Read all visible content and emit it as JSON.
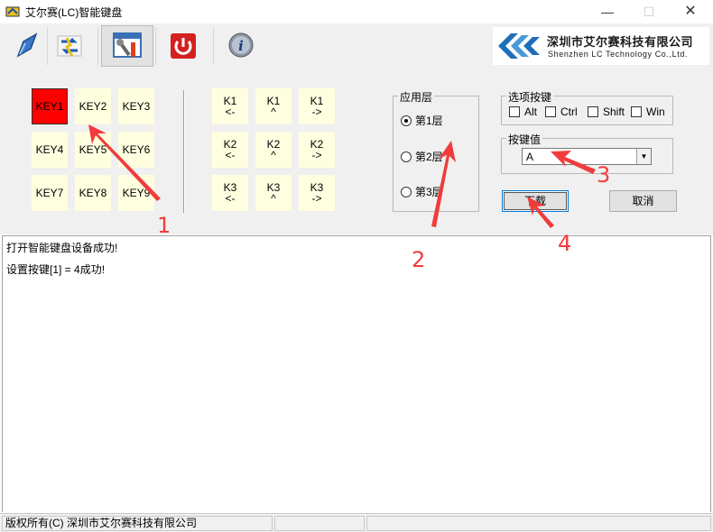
{
  "window": {
    "title": "艾尔赛(LC)智能键盘",
    "minimize": "—",
    "maximize": "☐",
    "close": "✕"
  },
  "toolbar": {
    "buttons": [
      {
        "icon": "connect-icon"
      },
      {
        "icon": "exchange-icon"
      },
      {
        "icon": "tools-settings-icon"
      },
      {
        "icon": "power-icon"
      },
      {
        "icon": "info-icon"
      }
    ]
  },
  "logo": {
    "company_cn": "深圳市艾尔赛科技有限公司",
    "company_en": "Shenzhen LC Technology Co.,Ltd."
  },
  "keys": [
    "KEY1",
    "KEY2",
    "KEY3",
    "KEY4",
    "KEY5",
    "KEY6",
    "KEY7",
    "KEY8",
    "KEY9"
  ],
  "selected_key": "KEY1",
  "knobs": [
    {
      "name": "K1",
      "left": "<-",
      "press": "^",
      "right": "->"
    },
    {
      "name": "K2",
      "left": "<-",
      "press": "^",
      "right": "->"
    },
    {
      "name": "K3",
      "left": "<-",
      "press": "^",
      "right": "->"
    }
  ],
  "layer_group": {
    "label": "应用层",
    "options": [
      "第1层",
      "第2层",
      "第3层"
    ],
    "selected": "第1层"
  },
  "modifier_group": {
    "label": "选项按键",
    "options": [
      "Alt",
      "Ctrl",
      "Shift",
      "Win"
    ]
  },
  "key_value_group": {
    "label": "按键值",
    "value": "A"
  },
  "buttons": {
    "download": "下载",
    "cancel": "取消"
  },
  "log": [
    "打开智能键盘设备成功!",
    "设置按键[1] = 4成功!"
  ],
  "status": {
    "copyright": "版权所有(C) 深圳市艾尔赛科技有限公司"
  },
  "annotations": [
    "1",
    "2",
    "3",
    "4"
  ],
  "colors": {
    "selected_key": "#ff0000",
    "key_bg": "#ffffe0",
    "annotation": "#f03c3c",
    "brand_blue": "#1e6fb8"
  }
}
